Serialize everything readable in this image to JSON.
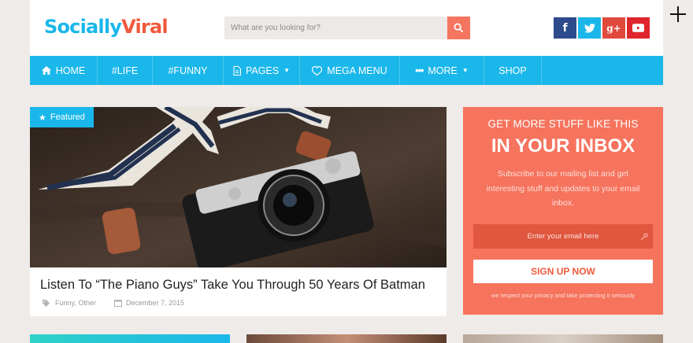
{
  "header": {
    "logo_part1": "Socially",
    "logo_part2": "Viral",
    "search_placeholder": "What are you looking for?",
    "social": [
      "f",
      "t",
      "g+",
      "yt"
    ]
  },
  "nav": {
    "items": [
      {
        "label": "HOME",
        "icon": "home-icon"
      },
      {
        "label": "#LIFE",
        "icon": ""
      },
      {
        "label": "#FUNNY",
        "icon": ""
      },
      {
        "label": "PAGES",
        "icon": "file-icon",
        "dropdown": true
      },
      {
        "label": "MEGA MENU",
        "icon": "heart-icon"
      },
      {
        "label": "MORE",
        "icon": "ellipsis-icon",
        "dropdown": true
      },
      {
        "label": "SHOP",
        "icon": ""
      }
    ]
  },
  "featured": {
    "badge": "Featured",
    "title": "Listen To “The Piano Guys” Take You Through 50 Years Of Batman",
    "categories": "Funny, Other",
    "date": "December 7, 2015"
  },
  "newsletter": {
    "line1": "GET MORE STUFF LIKE THIS",
    "line2": "IN YOUR INBOX",
    "description": "Subscribe to our mailing list and get interesting stuff and updates to your email inbox.",
    "email_placeholder": "Enter your email here",
    "button": "SIGN UP NOW",
    "privacy": "we respect your privacy and take protecting it seriously"
  },
  "colors": {
    "accent": "#1ab7ea",
    "coral": "#f6735d",
    "background": "#efebe8"
  }
}
